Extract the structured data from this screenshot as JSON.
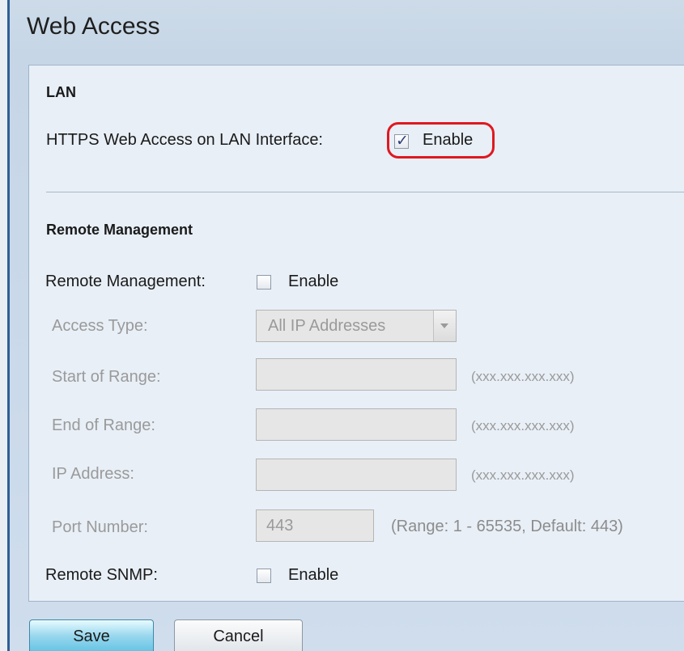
{
  "page": {
    "title": "Web Access"
  },
  "lan": {
    "section_title": "LAN",
    "https_label": "HTTPS Web Access on LAN Interface:",
    "https_enable_label": "Enable",
    "https_enabled": true
  },
  "remote": {
    "section_title": "Remote Management",
    "management_label": "Remote Management:",
    "management_enable_label": "Enable",
    "management_enabled": false,
    "access_type_label": "Access Type:",
    "access_type_value": "All IP Addresses",
    "start_label": "Start of Range:",
    "start_value": "",
    "start_hint": "(xxx.xxx.xxx.xxx)",
    "end_label": "End of Range:",
    "end_value": "",
    "end_hint": "(xxx.xxx.xxx.xxx)",
    "ip_label": "IP Address:",
    "ip_value": "",
    "ip_hint": "(xxx.xxx.xxx.xxx)",
    "port_label": "Port Number:",
    "port_value": "443",
    "port_hint": "(Range: 1 - 65535, Default: 443)",
    "snmp_label": "Remote SNMP:",
    "snmp_enable_label": "Enable",
    "snmp_enabled": false
  },
  "buttons": {
    "save_label": "Save",
    "cancel_label": "Cancel"
  },
  "colors": {
    "highlight": "#e01820",
    "save_button": "#5cc0e2",
    "panel_background": "#e8eff7"
  }
}
